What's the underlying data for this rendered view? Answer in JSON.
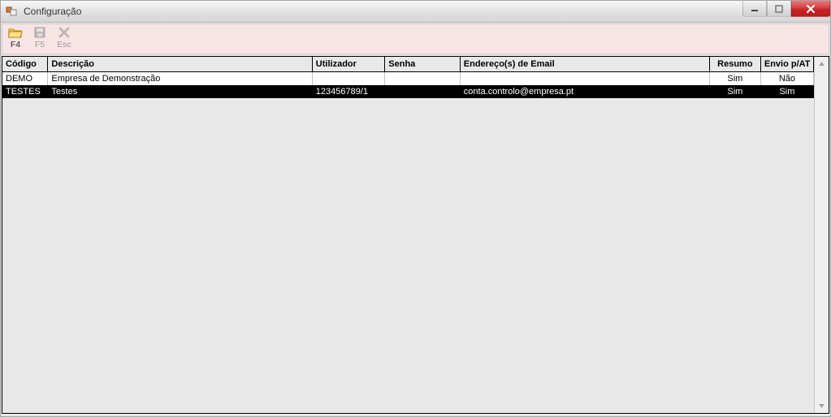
{
  "window": {
    "title": "Configuração"
  },
  "toolbar": {
    "items": [
      {
        "id": "f4",
        "label": "F4",
        "icon": "open-folder-icon",
        "enabled": true
      },
      {
        "id": "f5",
        "label": "F5",
        "icon": "save-icon",
        "enabled": false
      },
      {
        "id": "esc",
        "label": "Esc",
        "icon": "cancel-icon",
        "enabled": false
      }
    ]
  },
  "grid": {
    "columns": [
      {
        "key": "codigo",
        "label": "Código",
        "align": "left"
      },
      {
        "key": "descricao",
        "label": "Descrição",
        "align": "left"
      },
      {
        "key": "utilizador",
        "label": "Utilizador",
        "align": "left"
      },
      {
        "key": "senha",
        "label": "Senha",
        "align": "left"
      },
      {
        "key": "email",
        "label": "Endereço(s) de Email",
        "align": "left"
      },
      {
        "key": "resumo",
        "label": "Resumo",
        "align": "center"
      },
      {
        "key": "envio",
        "label": "Envio p/AT",
        "align": "center"
      }
    ],
    "rows": [
      {
        "codigo": "DEMO",
        "descricao": "Empresa de Demonstração",
        "utilizador": "",
        "senha": "",
        "email": "",
        "resumo": "Sim",
        "envio": "Não",
        "selected": false
      },
      {
        "codigo": "TESTES",
        "descricao": "Testes",
        "utilizador": "123456789/1",
        "senha": "",
        "email": "conta.controlo@empresa.pt",
        "resumo": "Sim",
        "envio": "Sim",
        "selected": true
      }
    ]
  }
}
